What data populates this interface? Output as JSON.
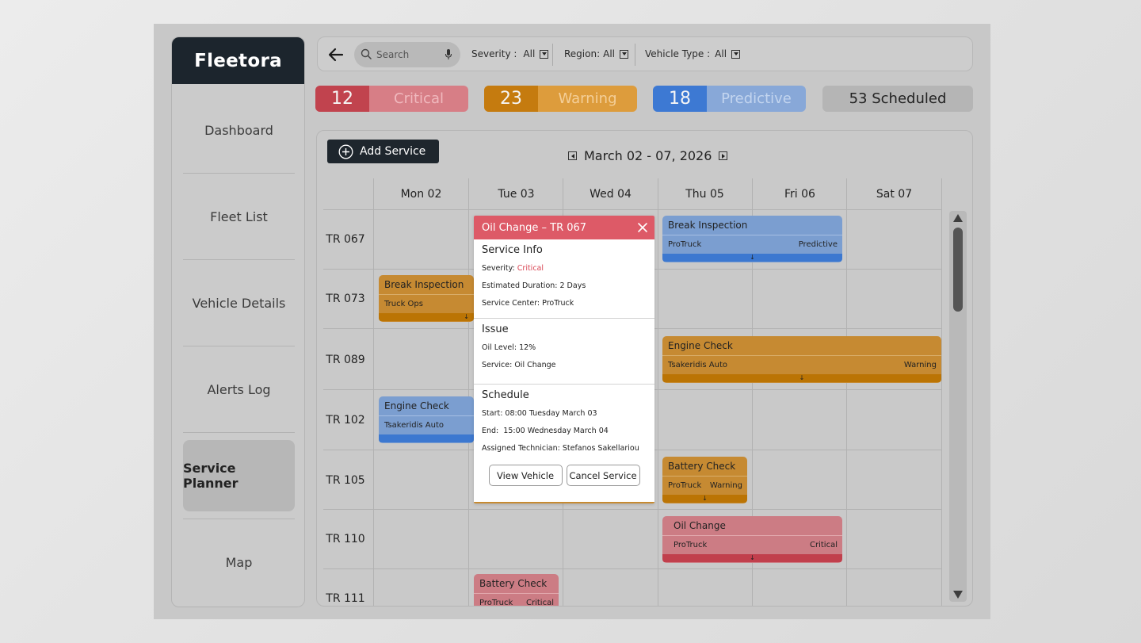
{
  "sidebar": {
    "brand": "Fleetora",
    "items": [
      {
        "label": "Dashboard"
      },
      {
        "label": "Fleet List"
      },
      {
        "label": "Vehicle Details"
      },
      {
        "label": "Alerts Log"
      },
      {
        "label": "Service Planner",
        "active": true
      },
      {
        "label": "Map"
      }
    ]
  },
  "filters": {
    "search_placeholder": "Search",
    "severity_label": "Severity :",
    "severity_value": "All",
    "region_label": "Region:",
    "region_value": "All",
    "vehicle_type_label": "Vehicle Type :",
    "vehicle_type_value": "All"
  },
  "summary": {
    "critical_count": "12",
    "critical_label": "Critical",
    "warning_count": "23",
    "warning_label": "Warning",
    "predictive_count": "18",
    "predictive_label": "Predictive",
    "scheduled": "53 Scheduled"
  },
  "calendar": {
    "add_service_label": "Add Service",
    "date_range": "March 02 - 07, 2026",
    "days": [
      "Mon 02",
      "Tue 03",
      "Wed 04",
      "Thu 05",
      "Fri 06",
      "Sat 07"
    ],
    "rows": [
      "TR 067",
      "TR 073",
      "TR 089",
      "TR 102",
      "TR 105",
      "TR 110",
      "TR 111"
    ],
    "events": [
      {
        "title": "Break Inspection",
        "center": "ProTruck",
        "severity": "Predictive"
      },
      {
        "title": "Break Inspection",
        "center": "Truck Ops",
        "severity": ""
      },
      {
        "title": "Engine Check",
        "center": "Tsakeridis Auto",
        "severity": "Warning"
      },
      {
        "title": "Engine Check",
        "center": "Tsakeridis Auto",
        "severity": ""
      },
      {
        "title": "Battery Check",
        "center": "ProTruck",
        "severity": "Warning"
      },
      {
        "title": "Oil Change",
        "center": "ProTruck",
        "severity": "Critical"
      },
      {
        "title": "Battery Check",
        "center": "ProTruck",
        "severity": "Critical"
      }
    ]
  },
  "popup": {
    "title": "Oil Change – TR 067",
    "service_info_heading": "Service Info",
    "severity_label": "Severity:",
    "severity_value": "Critical",
    "duration": "Estimated Duration: 2 Days",
    "center": "Service Center: ProTruck",
    "issue_heading": "Issue",
    "oil_level": "Oil Level: 12%",
    "service": "Service: Oil Change",
    "schedule_heading": "Schedule",
    "start": "Start: 08:00 Tuesday March 03",
    "end": "End:  15:00 Wednesday March 04",
    "technician": "Assigned Technician: Stefanos Sakellariou",
    "view_vehicle_label": "View Vehicle",
    "cancel_service_label": "Cancel Service"
  },
  "colors": {
    "critical": "#c1434e",
    "warning": "#c57b0f",
    "predictive": "#3d79d3",
    "brand_dark": "#1c252d"
  }
}
